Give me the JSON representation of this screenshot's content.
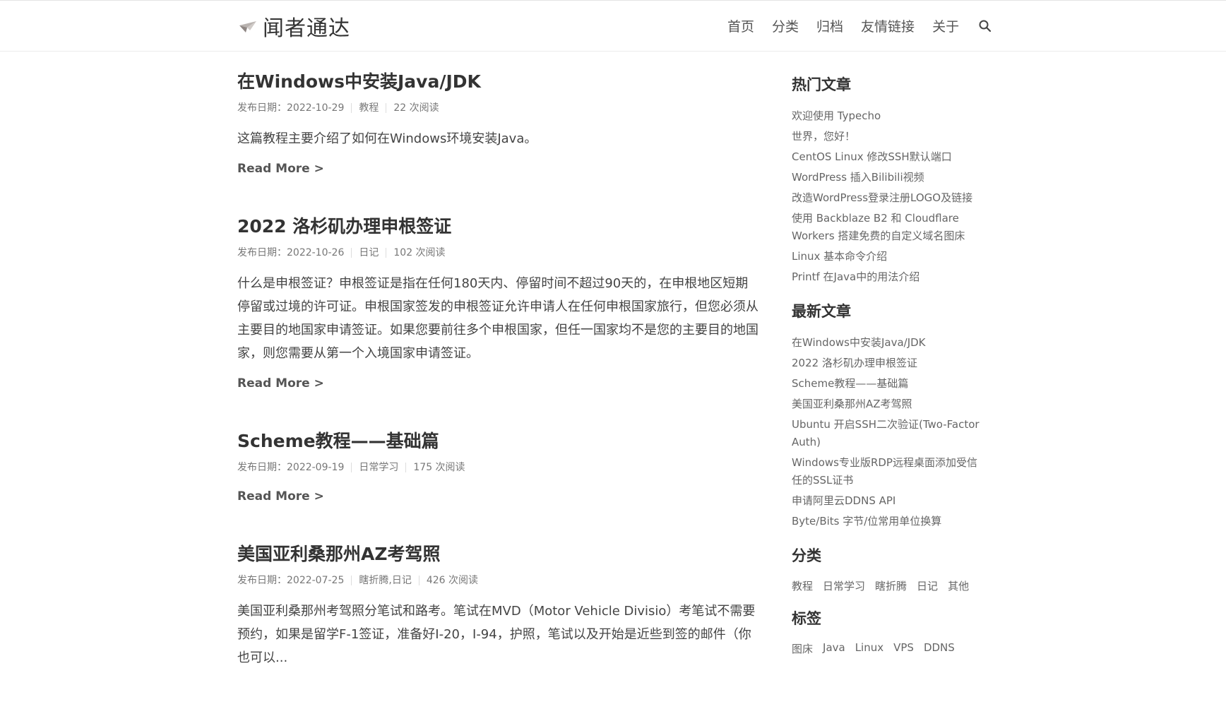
{
  "site": {
    "title": "闻者通达",
    "logo_icon": "paper-plane-icon"
  },
  "nav": {
    "items": [
      "首页",
      "分类",
      "归档",
      "友情链接",
      "关于"
    ],
    "search_icon": "search-icon"
  },
  "posts": [
    {
      "title": "在Windows中安装Java/JDK",
      "date": "发布日期：2022-10-29",
      "category": "教程",
      "views": "22 次阅读",
      "excerpt": "这篇教程主要介绍了如何在Windows环境安装Java。",
      "read_more": "Read More >"
    },
    {
      "title": "2022 洛杉矶办理申根签证",
      "date": "发布日期：2022-10-26",
      "category": "日记",
      "views": "102 次阅读",
      "excerpt": "什么是申根签证？申根签证是指在任何180天内、停留时间不超过90天的，在申根地区短期停留或过境的许可证。申根国家签发的申根签证允许申请人在任何申根国家旅行，但您必须从主要目的地国家申请签证。如果您要前往多个申根国家，但任一国家均不是您的主要目的地国家，则您需要从第一个入境国家申请签证。",
      "read_more": "Read More >"
    },
    {
      "title": "Scheme教程——基础篇",
      "date": "发布日期：2022-09-19",
      "category": "日常学习",
      "views": "175 次阅读",
      "excerpt": "",
      "read_more": "Read More >"
    },
    {
      "title": "美国亚利桑那州AZ考驾照",
      "date": "发布日期：2022-07-25",
      "category": "瞎折腾,日记",
      "views": "426 次阅读",
      "excerpt": "美国亚利桑那州考驾照分笔试和路考。笔试在MVD（Motor Vehicle Divisio）考笔试不需要预约，如果是留学F-1签证，准备好I-20，I-94，护照，笔试以及开始是近些到签的邮件（你也可以...",
      "read_more": "Read More >"
    }
  ],
  "sidebar": {
    "hot": {
      "title": "热门文章",
      "items": [
        "欢迎使用 Typecho",
        "世界，您好！",
        "CentOS Linux 修改SSH默认端口",
        "WordPress 插入Bilibili视频",
        "改造WordPress登录注册LOGO及链接",
        "使用 Backblaze B2 和 Cloudflare Workers 搭建免费的自定义域名图床",
        "Linux 基本命令介绍",
        "Printf 在Java中的用法介绍"
      ]
    },
    "latest": {
      "title": "最新文章",
      "items": [
        "在Windows中安装Java/JDK",
        "2022 洛杉矶办理申根签证",
        "Scheme教程——基础篇",
        "美国亚利桑那州AZ考驾照",
        "Ubuntu 开启SSH二次验证(Two-Factor Auth)",
        "Windows专业版RDP远程桌面添加受信任的SSL证书",
        "申请阿里云DDNS API",
        "Byte/Bits 字节/位常用单位换算"
      ]
    },
    "categories": {
      "title": "分类",
      "items": [
        "教程",
        "日常学习",
        "瞎折腾",
        "日记",
        "其他"
      ]
    },
    "tags": {
      "title": "标签",
      "items": [
        "图床",
        "Java",
        "Linux",
        "VPS",
        "DDNS"
      ]
    }
  }
}
